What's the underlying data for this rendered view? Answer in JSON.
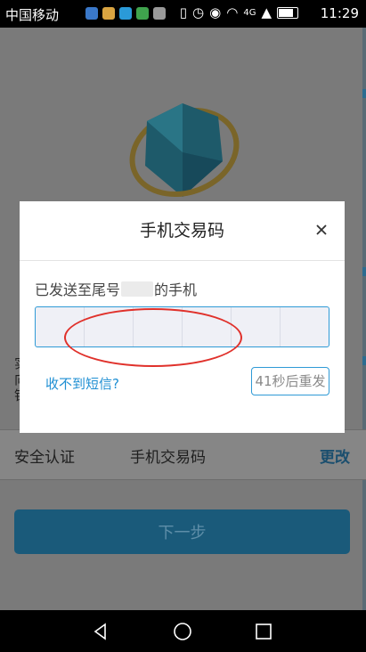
{
  "status_bar": {
    "carrier": "中国移动",
    "network": "4G",
    "time": "11:29"
  },
  "background": {
    "row": {
      "label_left": "安全认证",
      "label_center": "手机交易码",
      "action": "更改"
    },
    "next_button": "下一步",
    "partial_lines": [
      "实",
      "向",
      "银"
    ]
  },
  "dialog": {
    "title": "手机交易码",
    "sent_prefix": "已发送至尾号",
    "sent_suffix": "的手机",
    "no_sms_link": "收不到短信?",
    "resend_button": "41秒后重发",
    "code_cells": 6
  },
  "colors": {
    "accent": "#2f9ad6",
    "highlight": "#e0312b",
    "bg_dim": "#7a7a7a"
  }
}
